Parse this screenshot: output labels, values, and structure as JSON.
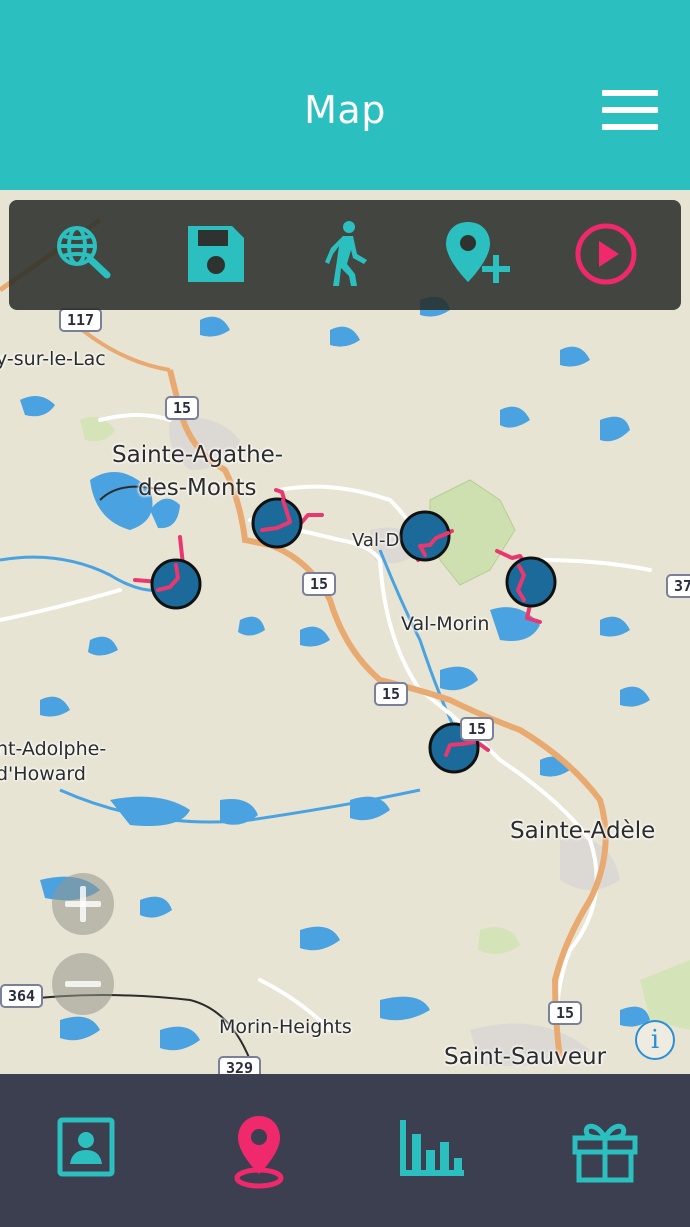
{
  "header": {
    "title": "Map"
  },
  "toolbar": {
    "icons": [
      "globe-search-icon",
      "save-icon",
      "walking-icon",
      "add-location-icon",
      "play-icon"
    ]
  },
  "map": {
    "places": {
      "lac": "y-sur-le-Lac",
      "sainte_agathe_1": "Sainte-Agathe-",
      "sainte_agathe_2": "des-Monts",
      "val_d": "Val-D",
      "val_morin": "Val-Morin",
      "adolphe_1": "nt-Adolphe-",
      "adolphe_2": "d'Howard",
      "sainte_adele": "Sainte-Adèle",
      "morin_heights": "Morin-Heights",
      "saint_sauveur": "Saint-Sauveur"
    },
    "routes": {
      "r117": "117",
      "r15a": "15",
      "r15b": "15",
      "r15c": "15",
      "r15d": "15",
      "r15e": "15",
      "r364": "364",
      "r329": "329",
      "r37": "37"
    },
    "info_label": "i"
  },
  "colors": {
    "header_bg": "#2bbfbf",
    "accent_teal": "#2bbfbf",
    "accent_pink": "#f0286c",
    "marker_fill": "#1b6a9a",
    "nav_bg": "#3b3f4f"
  },
  "bottom_nav": {
    "items": [
      "profile-icon",
      "map-pin-icon",
      "stats-icon",
      "gift-icon"
    ],
    "active": "map-pin-icon"
  }
}
